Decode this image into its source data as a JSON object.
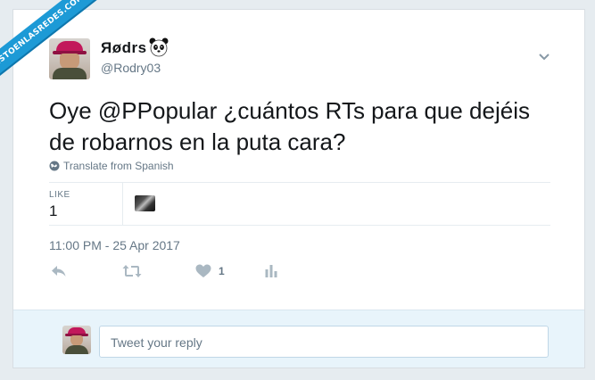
{
  "watermark": {
    "text": "VISTOENLASREDES.COM"
  },
  "tweet": {
    "display_name": "Яødrs",
    "handle": "@Rodry03",
    "text": "Oye @PPopular ¿cuántos RTs para que dejéis de robarnos en la puta cara?",
    "translate_label": "Translate from Spanish",
    "stats": {
      "like_label": "LIKE",
      "like_count": "1"
    },
    "timestamp": "11:00 PM - 25 Apr 2017",
    "actions": {
      "reply_icon": "reply-icon",
      "retweet_icon": "retweet-icon",
      "like_icon": "heart-icon",
      "like_count": "1",
      "analytics_icon": "bar-chart-icon"
    }
  },
  "reply": {
    "placeholder": "Tweet your reply"
  },
  "colors": {
    "text": "#14171a",
    "secondary": "#657786",
    "accent": "#1da1f2",
    "reply_bg": "#e8f4fb"
  }
}
